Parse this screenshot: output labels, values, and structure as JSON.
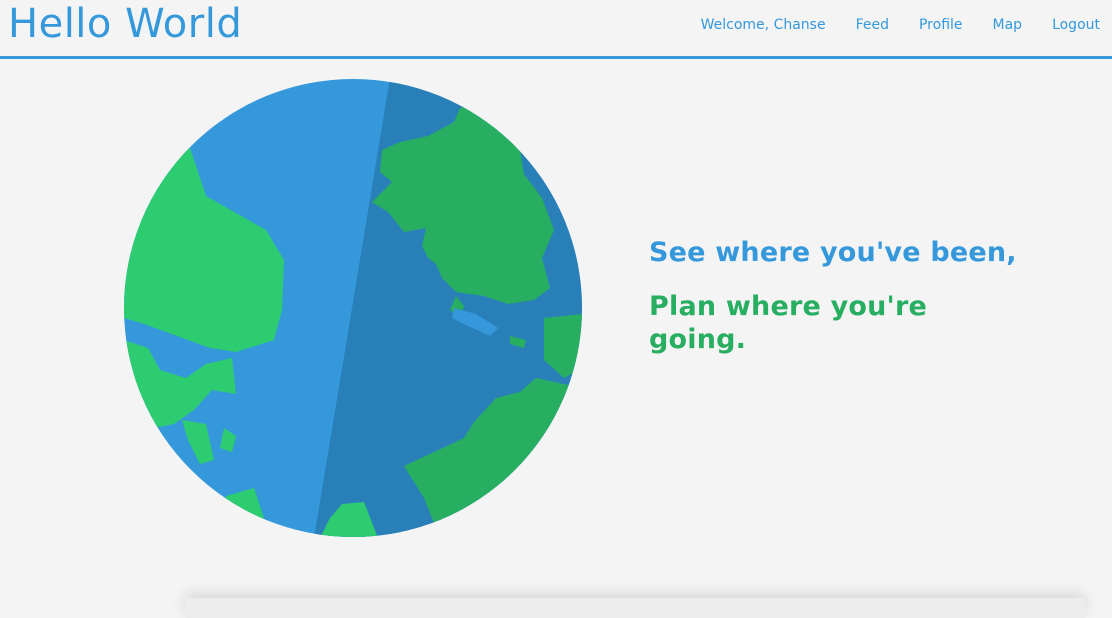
{
  "header": {
    "brand": "Hello World",
    "nav": {
      "welcome": "Welcome, Chanse",
      "feed": "Feed",
      "profile": "Profile",
      "map": "Map",
      "logout": "Logout"
    }
  },
  "hero": {
    "line1": "See where you've been,",
    "line2": "Plan where you're going."
  },
  "colors": {
    "ocean_light": "#3498db",
    "ocean_dark": "#2980b9",
    "land_light": "#2ecc71",
    "land_dark": "#27ae60",
    "background": "#f4f4f4"
  },
  "icons": {
    "globe": "globe-illustration"
  }
}
